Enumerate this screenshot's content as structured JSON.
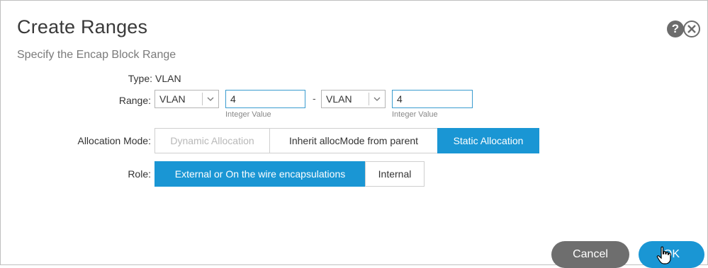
{
  "dialog": {
    "title": "Create Ranges",
    "subtitle": "Specify the Encap Block Range"
  },
  "form": {
    "type_label": "Type:",
    "type_value": "VLAN",
    "range_label": "Range:",
    "range_from_select": "VLAN",
    "range_from_value": "4",
    "range_from_hint": "Integer Value",
    "range_separator": "-",
    "range_to_select": "VLAN",
    "range_to_value": "4",
    "range_to_hint": "Integer Value",
    "allocation_label": "Allocation Mode:",
    "allocation_options": [
      "Dynamic Allocation",
      "Inherit allocMode from parent",
      "Static Allocation"
    ],
    "allocation_selected": "Static Allocation",
    "role_label": "Role:",
    "role_options": [
      "External or On the wire encapsulations",
      "Internal"
    ],
    "role_selected": "External or On the wire encapsulations"
  },
  "footer": {
    "cancel_label": "Cancel",
    "ok_label": "OK"
  },
  "icons": {
    "help": "help-icon",
    "close": "close-icon",
    "cursor": "hand-pointer-icon"
  },
  "colors": {
    "accent": "#1a96d4",
    "cancel": "#6e6e6e"
  }
}
